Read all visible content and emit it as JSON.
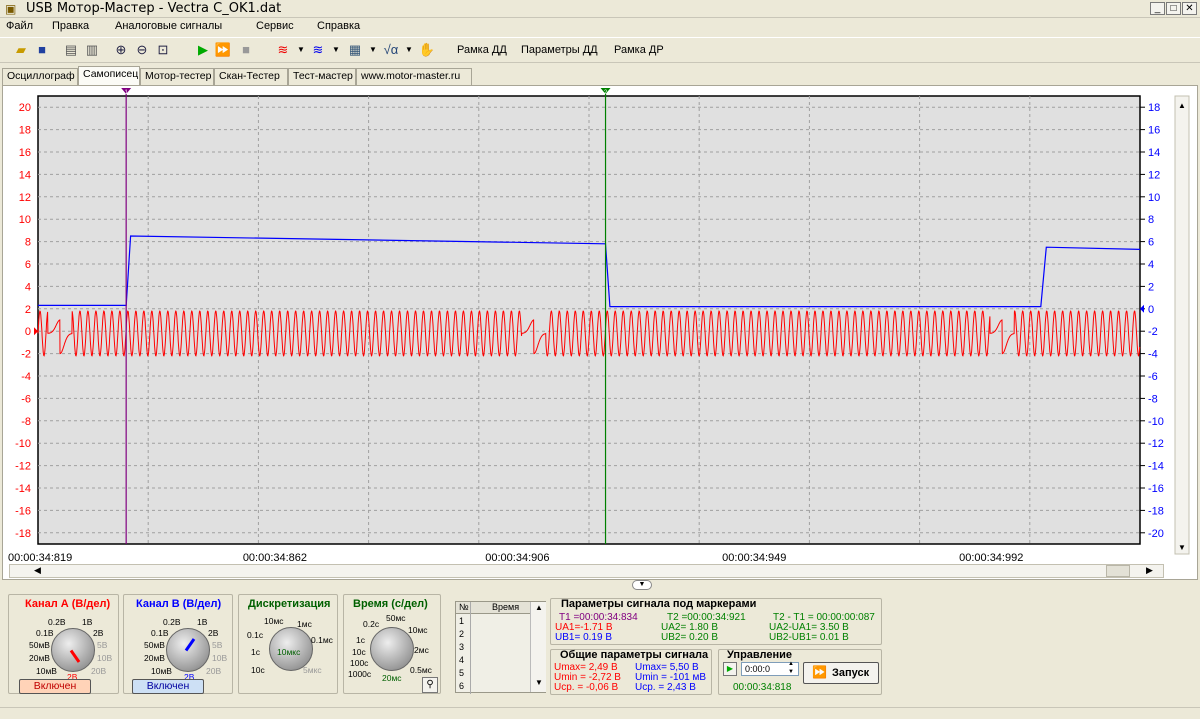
{
  "window": {
    "title": "USB Мотор-Мастер - Vectra C_OK1.dat",
    "min_label": "_",
    "max_label": "□",
    "close_label": "✕"
  },
  "menu": [
    "Файл",
    "Правка",
    "Аналоговые сигналы",
    "Сервис",
    "Справка"
  ],
  "toolbar": {
    "buttons_text": [
      "Рамка ДД",
      "Параметры ДД",
      "Рамка ДР"
    ]
  },
  "tabs": [
    {
      "label": "Осциллограф"
    },
    {
      "label": "Самописец",
      "active": true
    },
    {
      "label": "Мотор-тестер"
    },
    {
      "label": "Скан-Тестер"
    },
    {
      "label": "Тест-мастер"
    },
    {
      "label": "www.motor-master.ru"
    }
  ],
  "chart_data": {
    "type": "line",
    "left_axis": {
      "ticks": [
        "20",
        "18",
        "16",
        "14",
        "12",
        "10",
        "8",
        "6",
        "4",
        "2",
        "0",
        "-2",
        "-4",
        "-6",
        "-8",
        "-10",
        "-12",
        "-14",
        "-16",
        "-18"
      ],
      "color": "#ff0000",
      "ylim": [
        -19,
        21
      ]
    },
    "right_axis": {
      "ticks": [
        "18",
        "16",
        "14",
        "12",
        "10",
        "8",
        "6",
        "4",
        "2",
        "0",
        "-2",
        "-4",
        "-6",
        "-8",
        "-10",
        "-12",
        "-14",
        "-16",
        "-18",
        "-20"
      ],
      "color": "#0000ff",
      "ylim": [
        -21,
        19
      ]
    },
    "x_ticks": [
      "00:00:34:819",
      "00:00:34:862",
      "00:00:34:906",
      "00:00:34:949",
      "00:00:34:992"
    ],
    "x_ticks_ms": [
      34819,
      34862,
      34906,
      34949,
      34992
    ],
    "xlim_ms": [
      34819,
      35019
    ],
    "series": [
      {
        "color": "#0000ff",
        "axis": "right",
        "step_points": [
          [
            34819,
            0.3
          ],
          [
            34835,
            0.3
          ],
          [
            34835.8,
            6.5
          ],
          [
            34922,
            5.8
          ],
          [
            34922.8,
            0.2
          ],
          [
            35001,
            0.2
          ],
          [
            35002,
            5.5
          ],
          [
            35019,
            5.3
          ]
        ]
      },
      {
        "color": "#ff0000",
        "axis": "left",
        "waveform": {
          "center": -0.2,
          "amplitude": 2.0,
          "period_ms": 1.45,
          "glitches_ms": [
            34823,
            34909,
            34994
          ]
        }
      }
    ],
    "markers": [
      {
        "label": "1",
        "time": "00:00:34:834",
        "color": "#800080"
      },
      {
        "label": "2",
        "time": "00:00:34:921",
        "color": "#008000"
      }
    ]
  },
  "panels": {
    "channel_a": {
      "title": "Канал А (В/дел)",
      "ticks": [
        "0.2В",
        "1В",
        "0.1В",
        "2В",
        "50мВ",
        "5В",
        "20мВ",
        "10В",
        "10мВ",
        "20В"
      ],
      "value": "2В",
      "button": "Включен",
      "color": "#ff0000"
    },
    "channel_b": {
      "title": "Канал В (В/дел)",
      "ticks": [
        "0.2В",
        "1В",
        "0.1В",
        "2В",
        "50мВ",
        "5В",
        "20мВ",
        "10В",
        "10мВ",
        "20В"
      ],
      "value": "2В",
      "button": "Включен",
      "color": "#0000ff"
    },
    "discretization": {
      "title": "Дискретизация",
      "ticks": [
        "10мс",
        "1мс",
        "0.1с",
        "0.1мс",
        "1с",
        "10мкс",
        "10с",
        "5мкс"
      ],
      "value": "10мкс"
    },
    "time": {
      "title": "Время (с/дел)",
      "ticks": [
        "0.2с",
        "50мс",
        "1с",
        "10мс",
        "10с",
        "2мс",
        "100с",
        "0.5мс",
        "1000с"
      ],
      "value": "20мс"
    }
  },
  "table": {
    "col_num": "№",
    "col_time": "Время",
    "rows": [
      "1",
      "2",
      "3",
      "4",
      "5",
      "6"
    ]
  },
  "marker_params": {
    "title": "Параметры сигнала под маркерами",
    "t1": "T1 =00:00:34:834",
    "t2": "T2 =00:00:34:921",
    "dt": "T2 - T1 = 00:00:00:087",
    "ua1": "UA1=-1.71 В",
    "ua2": "UA2= 1.80 В",
    "dua": "UA2-UA1= 3.50 В",
    "ub1": "UB1= 0.19 В",
    "ub2": "UB2= 0.20 В",
    "dub": "UB2-UB1= 0.01 В"
  },
  "general_params": {
    "title": "Общие параметры сигнала",
    "a_max": "Umax= 2,49 В",
    "a_min": "Umin = -2,72 В",
    "a_avg": "Uср. = -0,06 В",
    "b_max": "Umax= 5,50 В",
    "b_min": "Umin = -101 мВ",
    "b_avg": "Uср. = 2,43 В"
  },
  "control": {
    "title": "Управление",
    "time_value": "0:00:0",
    "elapsed": "00:00:34:818",
    "start_button": "Запуск"
  },
  "colors": {
    "chA": "#ff0000",
    "chB": "#0000ff",
    "marker1": "#800080",
    "marker2": "#008000",
    "grid": "#a0a0a0",
    "plot_bg": "#e0e0e0"
  }
}
